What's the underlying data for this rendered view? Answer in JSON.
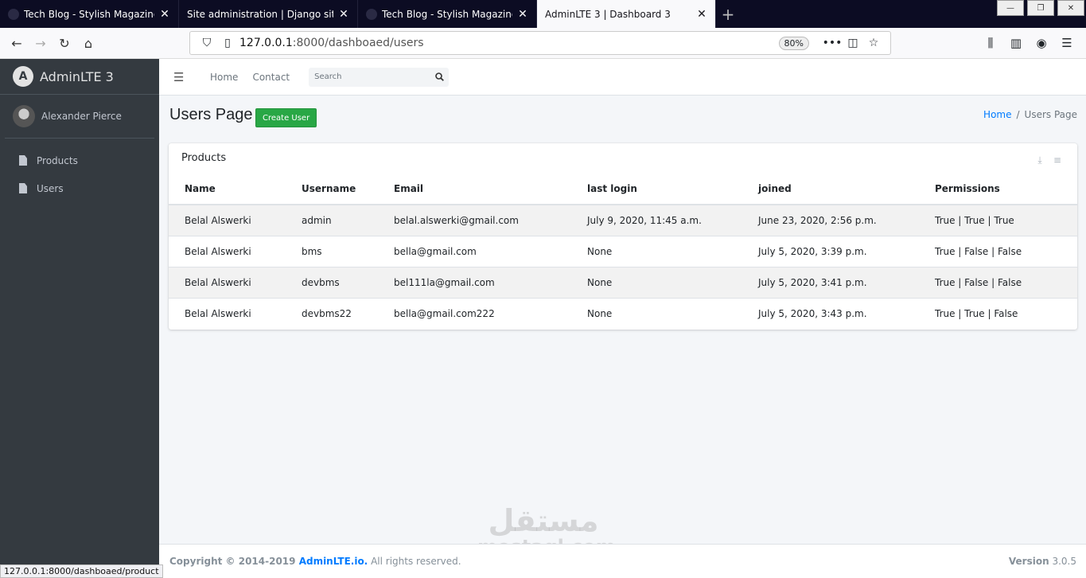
{
  "browser": {
    "tabs": [
      {
        "title": "Tech Blog - Stylish Magazine Bl",
        "active": false
      },
      {
        "title": "Site administration | Django site adi",
        "active": false
      },
      {
        "title": "Tech Blog - Stylish Magazine Bl",
        "active": false
      },
      {
        "title": "AdminLTE 3 | Dashboard 3",
        "active": true
      }
    ],
    "url_host": "127.0.0.1",
    "url_rest": ":8000/dashboaed/users",
    "zoom": "80%",
    "status_url": "127.0.0.1:8000/dashboaed/product"
  },
  "sidebar": {
    "brand": "AdminLTE 3",
    "brand_logo_letter": "A",
    "user_name": "Alexander Pierce",
    "items": [
      {
        "label": "Products"
      },
      {
        "label": "Users"
      }
    ]
  },
  "topnav": {
    "home": "Home",
    "contact": "Contact",
    "search_placeholder": "Search"
  },
  "header": {
    "title": "Users Page",
    "create_button": "Create User",
    "breadcrumb_home": "Home",
    "breadcrumb_sep": "/",
    "breadcrumb_current": "Users Page"
  },
  "card": {
    "title": "Products",
    "columns": [
      "Name",
      "Username",
      "Email",
      "last login",
      "joined",
      "Permissions"
    ],
    "rows": [
      {
        "name": "Belal Alswerki",
        "username": "admin",
        "email": "belal.alswerki@gmail.com",
        "last_login": "July 9, 2020, 11:45 a.m.",
        "joined": "June 23, 2020, 2:56 p.m.",
        "permissions": "True | True | True"
      },
      {
        "name": "Belal Alswerki",
        "username": "bms",
        "email": "bella@gmail.com",
        "last_login": "None",
        "joined": "July 5, 2020, 3:39 p.m.",
        "permissions": "True | False | False"
      },
      {
        "name": "Belal Alswerki",
        "username": "devbms",
        "email": "bel111la@gmail.com",
        "last_login": "None",
        "joined": "July 5, 2020, 3:41 p.m.",
        "permissions": "True | False | False"
      },
      {
        "name": "Belal Alswerki",
        "username": "devbms22",
        "email": "bella@gmail.com222",
        "last_login": "None",
        "joined": "July 5, 2020, 3:43 p.m.",
        "permissions": "True | True | False"
      }
    ]
  },
  "footer": {
    "copyright": "Copyright © 2014-2019 ",
    "brand_link": "AdminLTE.io.",
    "rights": " All rights reserved.",
    "version_label": "Version",
    "version_value": " 3.0.5"
  },
  "watermark": {
    "arabic": "مستقل",
    "latin": "mostaql.com"
  },
  "colors": {
    "sidebar_bg": "#343a40",
    "accent_blue": "#007bff",
    "create_green": "#28a745"
  }
}
